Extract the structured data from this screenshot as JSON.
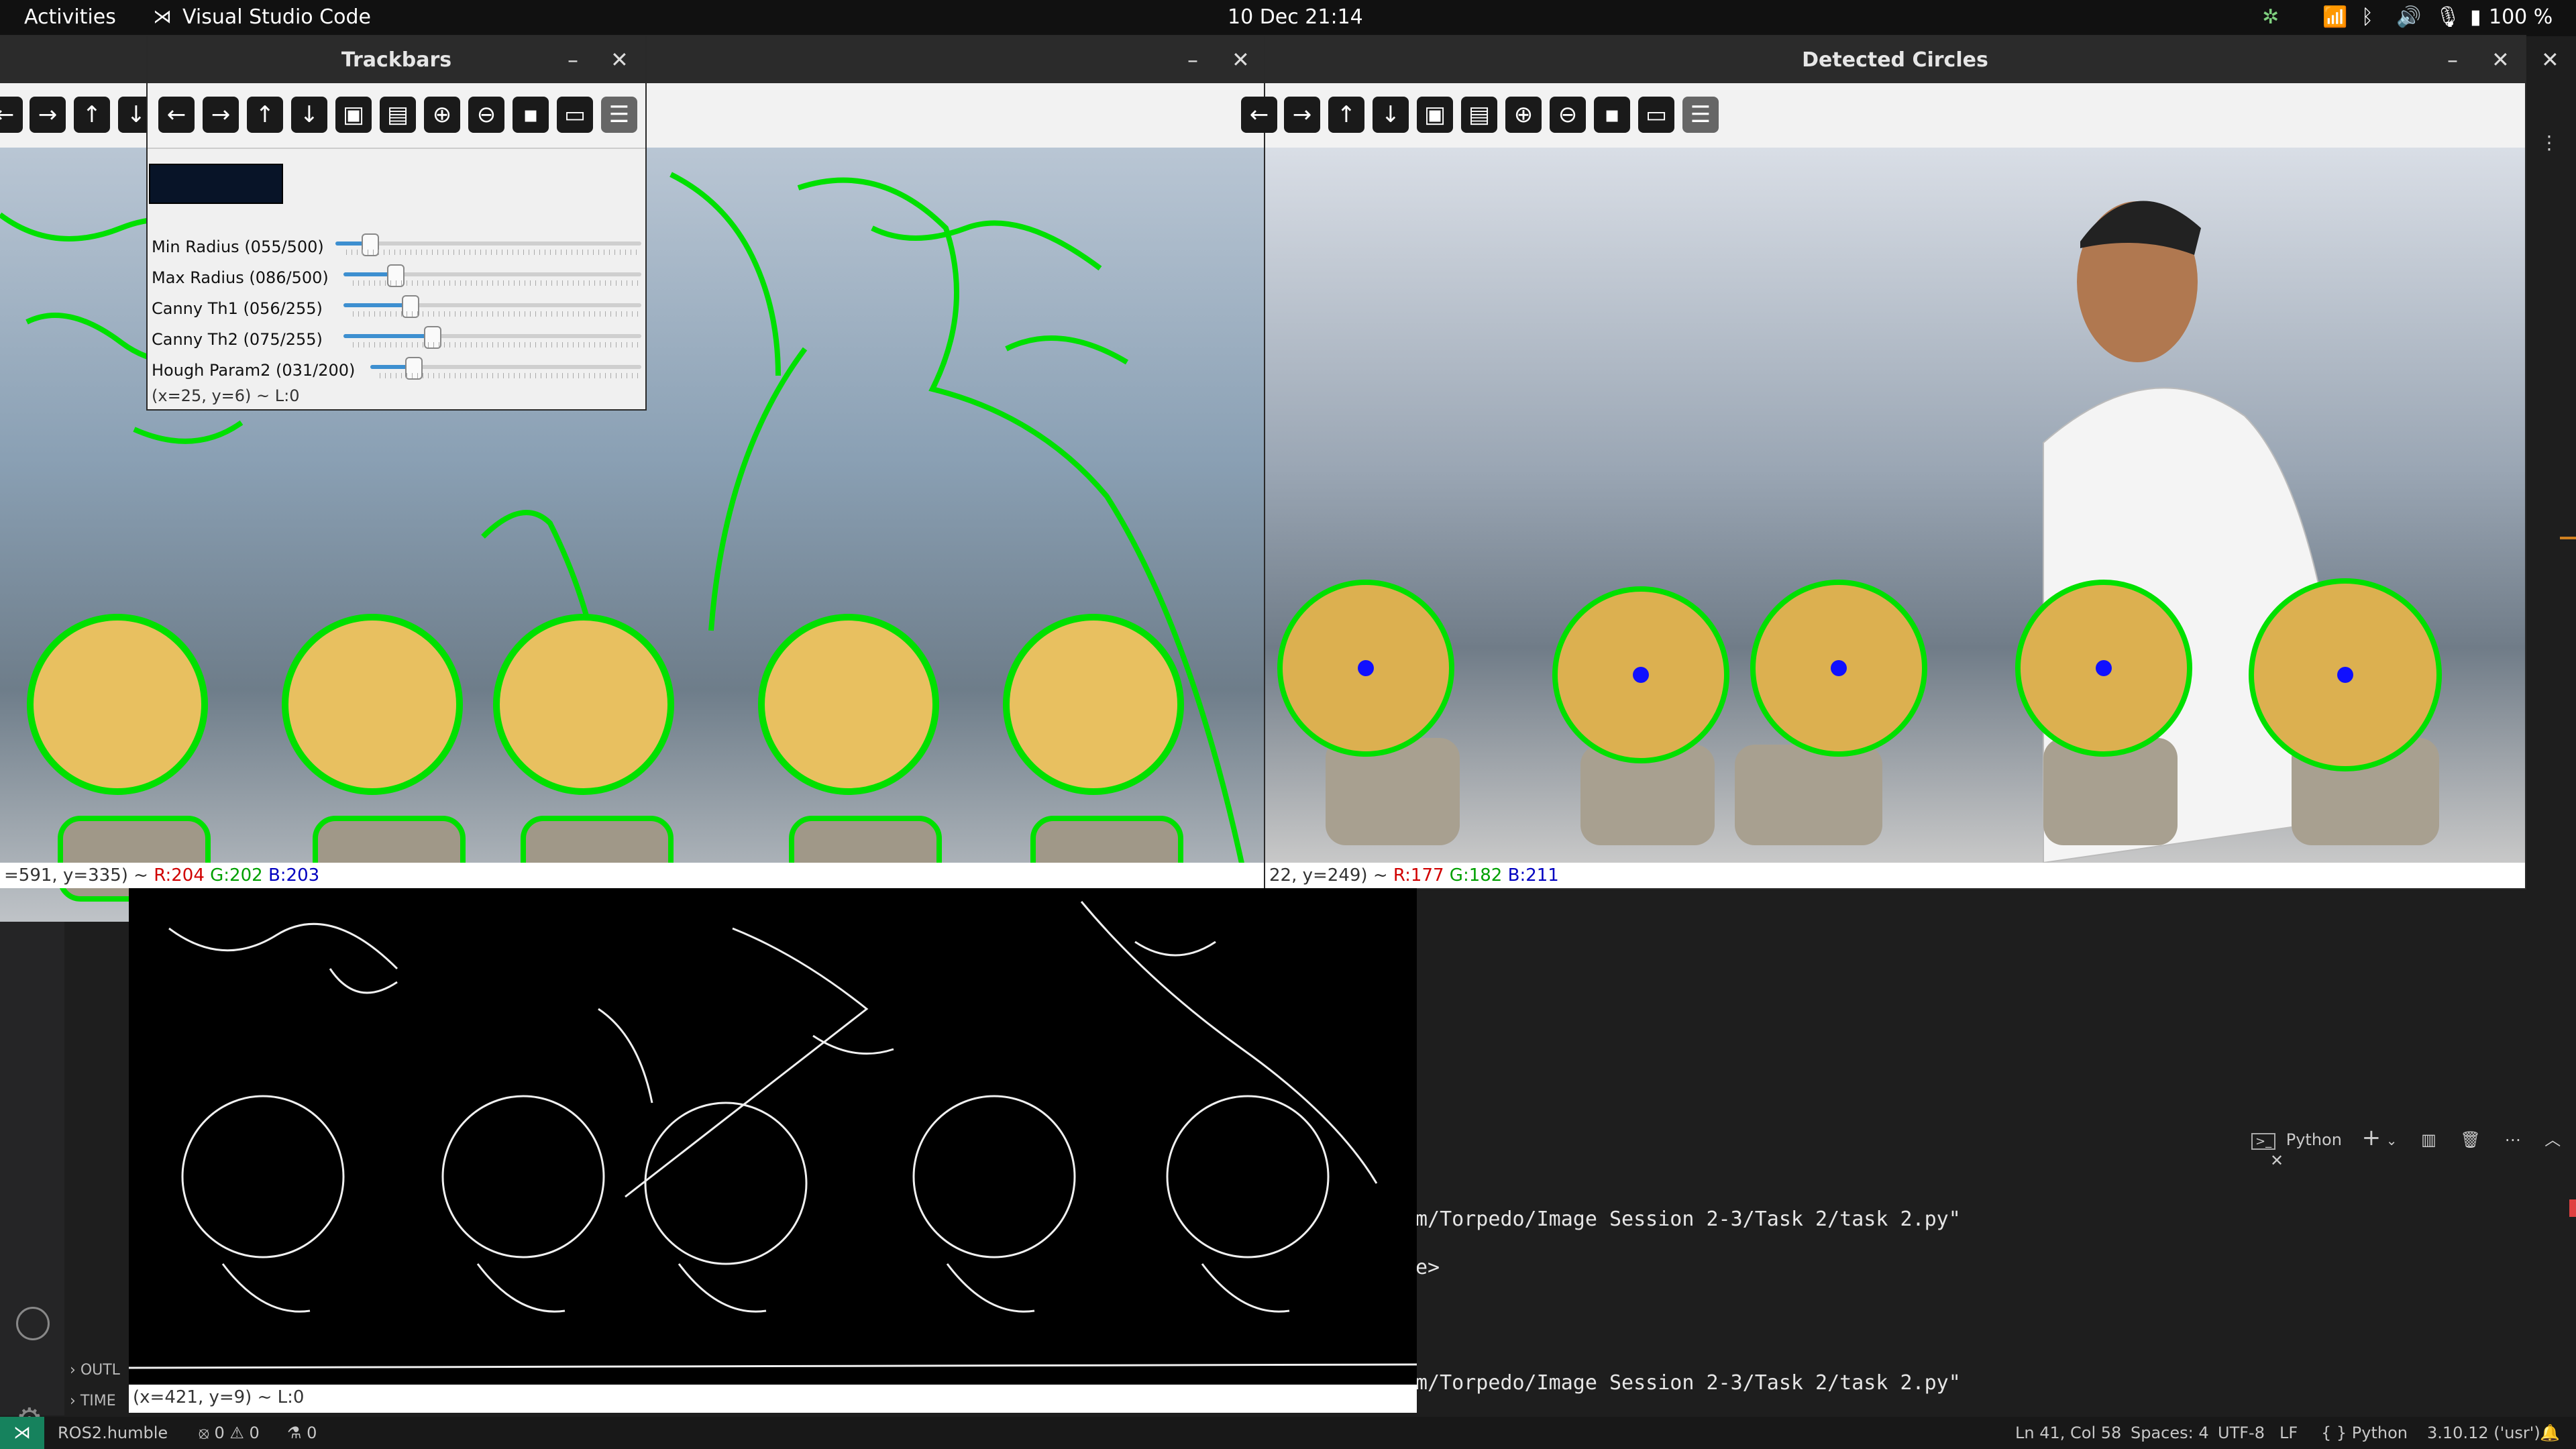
{
  "topbar": {
    "activities": "Activities",
    "app_name": "Visual Studio Code",
    "clock": "10 Dec  21:14",
    "battery": "100 %"
  },
  "windows": {
    "left": {
      "title": "rs",
      "status": "=591, y=335) ~ ",
      "r": "R:204",
      "g": "G:202",
      "b": "B:203"
    },
    "detected": {
      "title": "Detected Circles",
      "status": "22, y=249) ~ ",
      "r": "R:177",
      "g": "G:182",
      "b": "B:211"
    },
    "trackbars": {
      "title": "Trackbars",
      "status": "(x=25, y=6) ~ L:0",
      "sliders": [
        {
          "label": "Min Radius (055/500)",
          "value": 55,
          "max": 500
        },
        {
          "label": "Max Radius (086/500)",
          "value": 86,
          "max": 500
        },
        {
          "label": "Canny Th1  (056/255)",
          "value": 56,
          "max": 255
        },
        {
          "label": "Canny Th2  (075/255)",
          "value": 75,
          "max": 255
        },
        {
          "label": "Hough Param2 (031/200)",
          "value": 31,
          "max": 200
        }
      ]
    },
    "canny": {
      "status": "(x=421, y=9) ~ L:0"
    }
  },
  "vscode": {
    "terminal_lines": [
      "m/Torpedo/Image Session 2-3/Task 2/task 2.py\"",
      "e>",
      "m/Torpedo/Image Session 2-3/Task 2/task 2.py\""
    ],
    "terminal_tab": "Python",
    "outline_label": "OUTL",
    "timeline_label": "TIME",
    "status": {
      "remote": "ROS2.humble",
      "problems": "⦻ 0 ⚠ 0",
      "ports": "⚗ 0",
      "cursor": "Ln 41, Col 58",
      "spaces": "Spaces: 4",
      "encoding": "UTF-8",
      "eol": "LF",
      "language": "{ } Python",
      "interpreter": "3.10.12 ('usr')"
    }
  },
  "colors": {
    "circle": "#00e000",
    "center": "#1010ff",
    "toolbar_icon": "#1a1a1a"
  }
}
